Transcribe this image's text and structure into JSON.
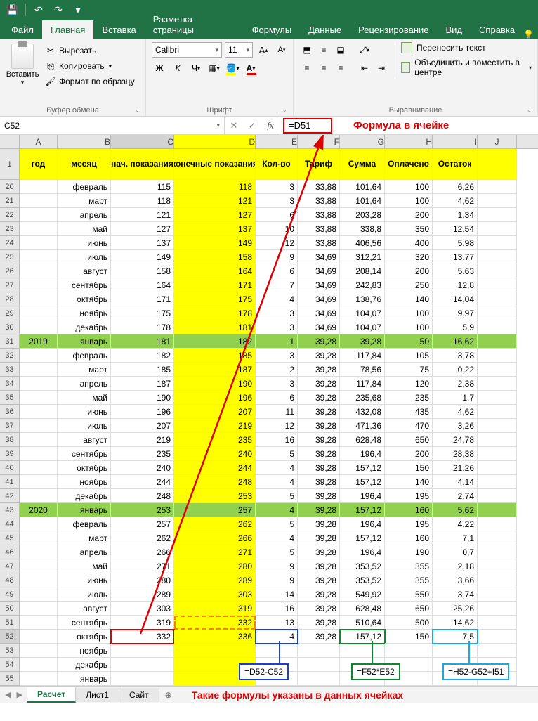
{
  "qat": {
    "save": "💾",
    "undo": "↶",
    "redo": "↷"
  },
  "tabs": [
    "Файл",
    "Главная",
    "Вставка",
    "Разметка страницы",
    "Формулы",
    "Данные",
    "Рецензирование",
    "Вид",
    "Справка"
  ],
  "activeTab": 1,
  "ribbon": {
    "paste": "Вставить",
    "cut": "Вырезать",
    "copy": "Копировать",
    "format_painter": "Формат по образцу",
    "clipboard_label": "Буфер обмена",
    "font_name": "Calibri",
    "font_size": "11",
    "font_label": "Шрифт",
    "wrap": "Переносить текст",
    "merge": "Объединить и поместить в центре",
    "align_label": "Выравнивание"
  },
  "nameBox": "C52",
  "formula": "=D51",
  "formula_annot": "Формула в ячейке",
  "colHeaders": [
    "A",
    "B",
    "C",
    "D",
    "E",
    "F",
    "G",
    "H",
    "I",
    "J"
  ],
  "headerRow": [
    "год",
    "месяц",
    "нач. показания",
    "конечные показания",
    "Кол-во",
    "Тариф",
    "Сумма",
    "Оплачено",
    "Остаток",
    ""
  ],
  "rows": [
    {
      "n": 20,
      "c": [
        "",
        "февраль",
        "115",
        "118",
        "3",
        "33,88",
        "101,64",
        "100",
        "6,26",
        ""
      ]
    },
    {
      "n": 21,
      "c": [
        "",
        "март",
        "118",
        "121",
        "3",
        "33,88",
        "101,64",
        "100",
        "4,62",
        ""
      ]
    },
    {
      "n": 22,
      "c": [
        "",
        "апрель",
        "121",
        "127",
        "6",
        "33,88",
        "203,28",
        "200",
        "1,34",
        ""
      ]
    },
    {
      "n": 23,
      "c": [
        "",
        "май",
        "127",
        "137",
        "10",
        "33,88",
        "338,8",
        "350",
        "12,54",
        ""
      ]
    },
    {
      "n": 24,
      "c": [
        "",
        "июнь",
        "137",
        "149",
        "12",
        "33,88",
        "406,56",
        "400",
        "5,98",
        ""
      ]
    },
    {
      "n": 25,
      "c": [
        "",
        "июль",
        "149",
        "158",
        "9",
        "34,69",
        "312,21",
        "320",
        "13,77",
        ""
      ]
    },
    {
      "n": 26,
      "c": [
        "",
        "август",
        "158",
        "164",
        "6",
        "34,69",
        "208,14",
        "200",
        "5,63",
        ""
      ]
    },
    {
      "n": 27,
      "c": [
        "",
        "сентябрь",
        "164",
        "171",
        "7",
        "34,69",
        "242,83",
        "250",
        "12,8",
        ""
      ]
    },
    {
      "n": 28,
      "c": [
        "",
        "октябрь",
        "171",
        "175",
        "4",
        "34,69",
        "138,76",
        "140",
        "14,04",
        ""
      ]
    },
    {
      "n": 29,
      "c": [
        "",
        "ноябрь",
        "175",
        "178",
        "3",
        "34,69",
        "104,07",
        "100",
        "9,97",
        ""
      ]
    },
    {
      "n": 30,
      "c": [
        "",
        "декабрь",
        "178",
        "181",
        "3",
        "34,69",
        "104,07",
        "100",
        "5,9",
        ""
      ]
    },
    {
      "n": 31,
      "c": [
        "2019",
        "январь",
        "181",
        "182",
        "1",
        "39,28",
        "39,28",
        "50",
        "16,62",
        ""
      ],
      "green": true
    },
    {
      "n": 32,
      "c": [
        "",
        "февраль",
        "182",
        "185",
        "3",
        "39,28",
        "117,84",
        "105",
        "3,78",
        ""
      ]
    },
    {
      "n": 33,
      "c": [
        "",
        "март",
        "185",
        "187",
        "2",
        "39,28",
        "78,56",
        "75",
        "0,22",
        ""
      ]
    },
    {
      "n": 34,
      "c": [
        "",
        "апрель",
        "187",
        "190",
        "3",
        "39,28",
        "117,84",
        "120",
        "2,38",
        ""
      ]
    },
    {
      "n": 35,
      "c": [
        "",
        "май",
        "190",
        "196",
        "6",
        "39,28",
        "235,68",
        "235",
        "1,7",
        ""
      ]
    },
    {
      "n": 36,
      "c": [
        "",
        "июнь",
        "196",
        "207",
        "11",
        "39,28",
        "432,08",
        "435",
        "4,62",
        ""
      ]
    },
    {
      "n": 37,
      "c": [
        "",
        "июль",
        "207",
        "219",
        "12",
        "39,28",
        "471,36",
        "470",
        "3,26",
        ""
      ]
    },
    {
      "n": 38,
      "c": [
        "",
        "август",
        "219",
        "235",
        "16",
        "39,28",
        "628,48",
        "650",
        "24,78",
        ""
      ]
    },
    {
      "n": 39,
      "c": [
        "",
        "сентябрь",
        "235",
        "240",
        "5",
        "39,28",
        "196,4",
        "200",
        "28,38",
        ""
      ]
    },
    {
      "n": 40,
      "c": [
        "",
        "октябрь",
        "240",
        "244",
        "4",
        "39,28",
        "157,12",
        "150",
        "21,26",
        ""
      ]
    },
    {
      "n": 41,
      "c": [
        "",
        "ноябрь",
        "244",
        "248",
        "4",
        "39,28",
        "157,12",
        "140",
        "4,14",
        ""
      ]
    },
    {
      "n": 42,
      "c": [
        "",
        "декабрь",
        "248",
        "253",
        "5",
        "39,28",
        "196,4",
        "195",
        "2,74",
        ""
      ]
    },
    {
      "n": 43,
      "c": [
        "2020",
        "январь",
        "253",
        "257",
        "4",
        "39,28",
        "157,12",
        "160",
        "5,62",
        ""
      ],
      "green": true
    },
    {
      "n": 44,
      "c": [
        "",
        "февраль",
        "257",
        "262",
        "5",
        "39,28",
        "196,4",
        "195",
        "4,22",
        ""
      ]
    },
    {
      "n": 45,
      "c": [
        "",
        "март",
        "262",
        "266",
        "4",
        "39,28",
        "157,12",
        "160",
        "7,1",
        ""
      ]
    },
    {
      "n": 46,
      "c": [
        "",
        "апрель",
        "266",
        "271",
        "5",
        "39,28",
        "196,4",
        "190",
        "0,7",
        ""
      ]
    },
    {
      "n": 47,
      "c": [
        "",
        "май",
        "271",
        "280",
        "9",
        "39,28",
        "353,52",
        "355",
        "2,18",
        ""
      ]
    },
    {
      "n": 48,
      "c": [
        "",
        "июнь",
        "280",
        "289",
        "9",
        "39,28",
        "353,52",
        "355",
        "3,66",
        ""
      ]
    },
    {
      "n": 49,
      "c": [
        "",
        "июль",
        "289",
        "303",
        "14",
        "39,28",
        "549,92",
        "550",
        "3,74",
        ""
      ]
    },
    {
      "n": 50,
      "c": [
        "",
        "август",
        "303",
        "319",
        "16",
        "39,28",
        "628,48",
        "650",
        "25,26",
        ""
      ]
    },
    {
      "n": 51,
      "c": [
        "",
        "сентябрь",
        "319",
        "332",
        "13",
        "39,28",
        "510,64",
        "500",
        "14,62",
        ""
      ]
    },
    {
      "n": 52,
      "c": [
        "",
        "октябрь",
        "332",
        "336",
        "4",
        "39,28",
        "157,12",
        "150",
        "7,5",
        ""
      ]
    },
    {
      "n": 53,
      "c": [
        "",
        "ноябрь",
        "",
        "",
        "",
        "",
        "",
        "",
        "",
        ""
      ]
    },
    {
      "n": 54,
      "c": [
        "",
        "декабрь",
        "",
        "",
        "",
        "",
        "",
        "",
        "",
        ""
      ]
    },
    {
      "n": 55,
      "c": [
        "",
        "январь",
        "",
        "",
        "",
        "",
        "",
        "",
        "",
        ""
      ]
    }
  ],
  "annotations": {
    "e_formula": "=D52-C52",
    "g_formula": "=F52*E52",
    "i_formula": "=H52-G52+I51",
    "bottom_text": "Такие формулы указаны в данных ячейках"
  },
  "sheets": [
    "Расчет",
    "Лист1",
    "Сайт"
  ],
  "activeSheet": 0
}
